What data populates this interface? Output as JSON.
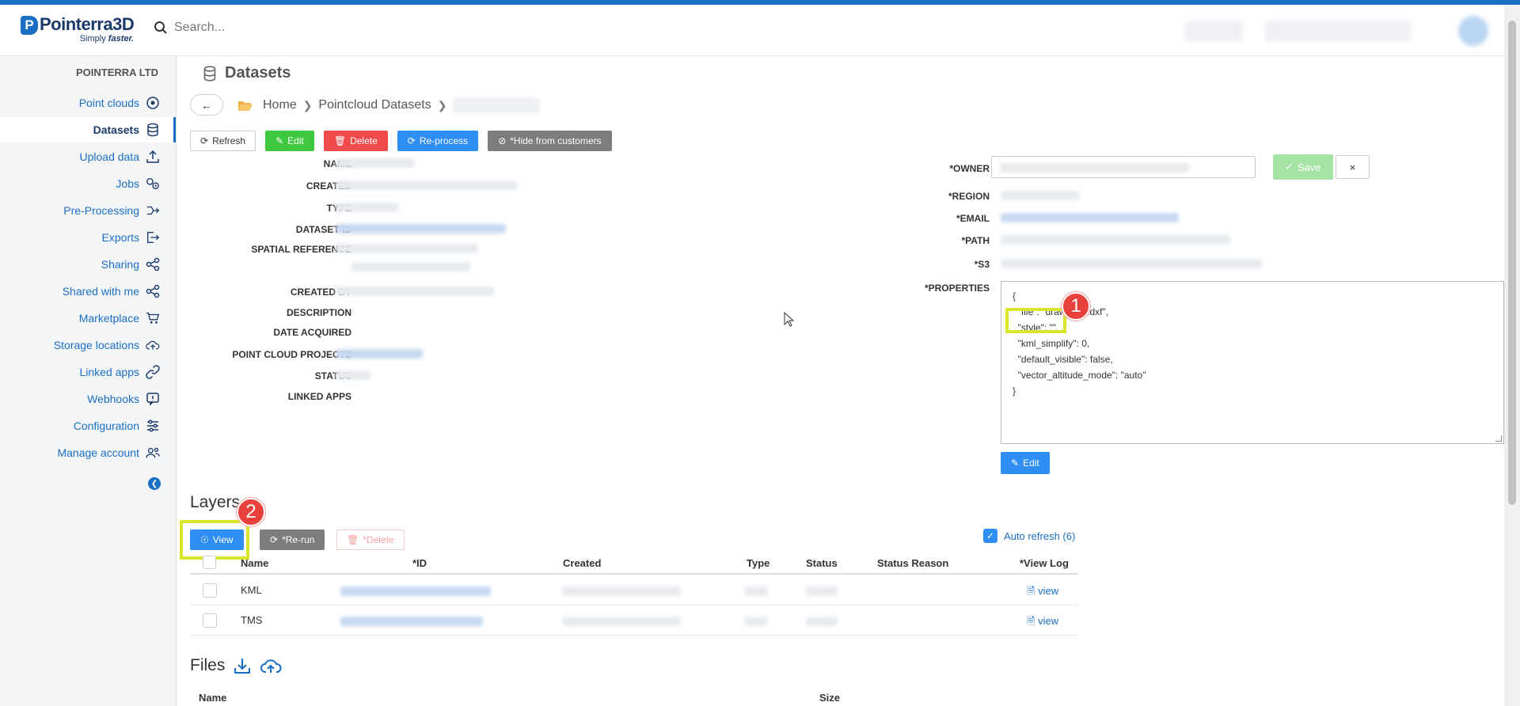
{
  "app": {
    "logo_mark": "P",
    "logo_name": "Pointerra3D",
    "logo_tag_prefix": "Simply",
    "logo_tag_emph": "faster.",
    "accent": "#1a6fc4"
  },
  "search": {
    "placeholder": "Search..."
  },
  "sidebar": {
    "org": "POINTERRA LTD",
    "items": [
      {
        "label": "Point clouds",
        "icon": "target-icon"
      },
      {
        "label": "Datasets",
        "icon": "database-icon",
        "active": true
      },
      {
        "label": "Upload data",
        "icon": "upload-icon"
      },
      {
        "label": "Jobs",
        "icon": "gears-icon"
      },
      {
        "label": "Pre-Processing",
        "icon": "process-icon"
      },
      {
        "label": "Exports",
        "icon": "export-icon"
      },
      {
        "label": "Sharing",
        "icon": "share-icon"
      },
      {
        "label": "Shared with me",
        "icon": "share-icon"
      },
      {
        "label": "Marketplace",
        "icon": "cart-icon"
      },
      {
        "label": "Storage locations",
        "icon": "cloud-upload-icon"
      },
      {
        "label": "Linked apps",
        "icon": "link-icon"
      },
      {
        "label": "Webhooks",
        "icon": "webhook-icon"
      },
      {
        "label": "Configuration",
        "icon": "sliders-icon"
      },
      {
        "label": "Manage account",
        "icon": "users-icon"
      }
    ]
  },
  "page": {
    "title": "Datasets"
  },
  "breadcrumb": {
    "home": "Home",
    "section": "Pointcloud Datasets"
  },
  "actions": {
    "refresh": "Refresh",
    "edit": "Edit",
    "delete": "Delete",
    "reprocess": "Re-process",
    "hide": "*Hide from customers"
  },
  "left_fields": [
    "NAME",
    "CREATED",
    "TYPE",
    "DATASET ID",
    "SPATIAL REFERENCE",
    "CREATED BY",
    "DESCRIPTION",
    "DATE ACQUIRED",
    "POINT CLOUD PROJECTS",
    "STATUS",
    "LINKED APPS"
  ],
  "right_fields": {
    "owner": "*OWNER",
    "region": "*REGION",
    "email": "*EMAIL",
    "path": "*PATH",
    "s3": "*S3",
    "properties": "*PROPERTIES",
    "save": "Save",
    "close": "×",
    "edit": "Edit"
  },
  "properties_lines": [
    "{",
    "  \"file\": \"draw        .dxf\",",
    "  \"style\": \"\",",
    "  \"kml_simplify\": 0,",
    "  \"default_visible\": false,",
    "  \"vector_altitude_mode\": \"auto\"",
    "}"
  ],
  "annotations": {
    "one": "1",
    "two": "2",
    "highlight_color": "#d9e62b",
    "badge_color": "#e8413b"
  },
  "layers": {
    "title": "Layers",
    "view": "View",
    "rerun": "*Re-run",
    "delete": "*Delete",
    "auto_refresh": "Auto refresh (6)",
    "columns": [
      "Name",
      "*ID",
      "Created",
      "Type",
      "Status",
      "Status Reason",
      "*View Log"
    ],
    "rows": [
      {
        "name": "KML",
        "log": "view"
      },
      {
        "name": "TMS",
        "log": "view"
      }
    ]
  },
  "files": {
    "title": "Files",
    "columns": [
      "Name",
      "Size"
    ]
  }
}
